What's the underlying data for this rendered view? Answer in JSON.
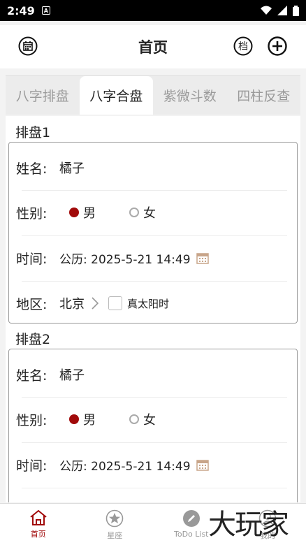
{
  "status": {
    "time": "2:49",
    "sim_icon": "A"
  },
  "header": {
    "title": "首页",
    "archive_label": "档",
    "left_icon": "calendar-icon",
    "add_icon": "plus-circle-icon"
  },
  "tabs": [
    {
      "label": "八字排盘",
      "active": false
    },
    {
      "label": "八字合盘",
      "active": true
    },
    {
      "label": "紫微斗数",
      "active": false
    },
    {
      "label": "四柱反查",
      "active": false
    }
  ],
  "chart1": {
    "title": "排盘1",
    "name_label": "姓名:",
    "name_value": "橘子",
    "gender_label": "性别:",
    "male": "男",
    "female": "女",
    "selected_gender": "男",
    "time_label": "时间:",
    "time_value": "公历: 2025-5-21 14:49",
    "region_label": "地区:",
    "region_value": "北京",
    "solar_time_label": "真太阳时"
  },
  "chart2": {
    "title": "排盘2",
    "name_label": "姓名:",
    "name_value": "橘子",
    "gender_label": "性别:",
    "male": "男",
    "female": "女",
    "selected_gender": "男",
    "time_label": "时间:",
    "time_value": "公历: 2025-5-21 14:49"
  },
  "tabbar": [
    {
      "label": "首页",
      "icon": "home-icon",
      "active": true
    },
    {
      "label": "星座",
      "icon": "star-icon",
      "active": false
    },
    {
      "label": "ToDo List",
      "icon": "pencil-icon",
      "active": false
    },
    {
      "label": "我的",
      "icon": "user-icon",
      "active": false
    }
  ],
  "watermark": "大玩家",
  "colors": {
    "accent": "#a10a0a",
    "tab_bg": "#ececec",
    "border": "#9a9a9a"
  }
}
